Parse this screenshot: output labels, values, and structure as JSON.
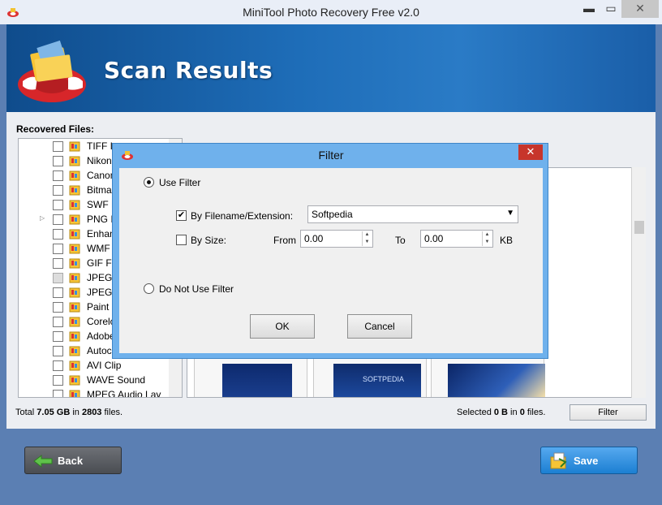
{
  "window": {
    "title": "MiniTool Photo Recovery Free v2.0",
    "min_glyph": "▬",
    "max_glyph": "▭",
    "close_glyph": "✕"
  },
  "banner": {
    "heading": "Scan Results"
  },
  "recovered_files": {
    "label": "Recovered Files:",
    "items": [
      {
        "label": "TIFF Ir",
        "checked": false
      },
      {
        "label": "Nikon",
        "checked": false
      },
      {
        "label": "Canon",
        "checked": false
      },
      {
        "label": "Bitmap",
        "checked": false
      },
      {
        "label": "SWF F",
        "checked": false
      },
      {
        "label": "PNG Ir",
        "checked": false,
        "expandable": true
      },
      {
        "label": "Enhan",
        "checked": false
      },
      {
        "label": "WMF I",
        "checked": false
      },
      {
        "label": "GIF Fil",
        "checked": false
      },
      {
        "label": "JPEG C",
        "checked": false,
        "disabled": true
      },
      {
        "label": "JPEG C",
        "checked": false
      },
      {
        "label": "Paint S",
        "checked": false
      },
      {
        "label": "Corelc",
        "checked": false
      },
      {
        "label": "Adobe",
        "checked": false
      },
      {
        "label": "Autoc",
        "checked": false
      },
      {
        "label": "AVI Clip",
        "checked": false
      },
      {
        "label": "WAVE Sound",
        "checked": false
      },
      {
        "label": "MPEG Audio Lay",
        "checked": false
      }
    ]
  },
  "thumbnails": [
    {
      "caption": ""
    },
    {
      "caption": "SOFTPEDIA"
    },
    {
      "caption": ""
    }
  ],
  "status": {
    "total_prefix": "Total ",
    "total_size": "7.05 GB",
    "total_mid": " in ",
    "total_files": "2803",
    "total_suffix": " files.",
    "selected_prefix": "Selected ",
    "selected_size": "0 B",
    "selected_mid": " in ",
    "selected_files": "0",
    "selected_suffix": " files."
  },
  "buttons": {
    "filter": "Filter",
    "back": "Back",
    "save": "Save"
  },
  "filter_dialog": {
    "title": "Filter",
    "close_glyph": "✕",
    "use_filter_label": "Use Filter",
    "use_filter_selected": true,
    "by_filename_label": "By Filename/Extension:",
    "by_filename_checked": true,
    "filename_value": "Softpedia",
    "by_size_label": "By Size:",
    "by_size_checked": false,
    "from_label": "From",
    "from_value": "0.00",
    "to_label": "To",
    "to_value": "0.00",
    "unit_label": "KB",
    "no_filter_label": "Do Not Use Filter",
    "ok_label": "OK",
    "cancel_label": "Cancel"
  },
  "colors": {
    "banner": "#1e6db8",
    "save": "#2a8be0",
    "back": "#5a5d62",
    "dialog_frame": "#6fb1ec"
  }
}
